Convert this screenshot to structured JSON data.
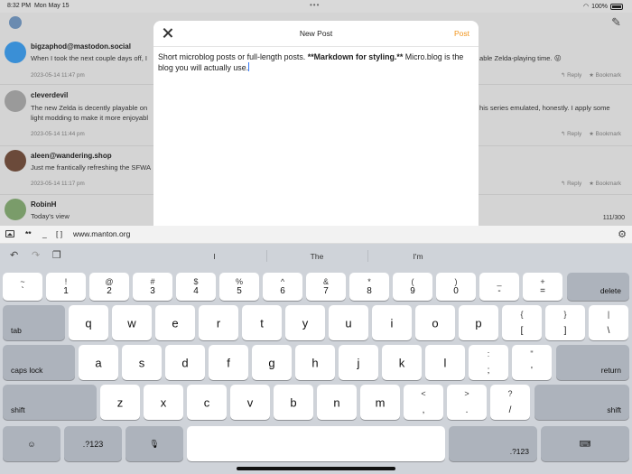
{
  "status": {
    "time": "8:32 PM",
    "date": "Mon May 15",
    "dots": "•••",
    "battery": "100%"
  },
  "timeline": {
    "counter": "111/300",
    "posts": [
      {
        "author": "bigzaphod@mastodon.social",
        "text_left": "When I took the next couple days off, I",
        "text_right": "able Zelda-playing time. 😜",
        "date": "2023-05-14 11:47 pm",
        "reply": "Reply",
        "bookmark": "Bookmark"
      },
      {
        "author": "cleverdevil",
        "text_left": "The new Zelda is decently playable on",
        "text_left2": "light modding to make it more enjoyabl",
        "text_right": "his series emulated, honestly. I apply some",
        "date": "2023-05-14 11:44 pm",
        "reply": "Reply",
        "bookmark": "Bookmark"
      },
      {
        "author": "aleen@wandering.shop",
        "text_left": "Just me frantically refreshing the SFWA",
        "date": "2023-05-14 11:17 pm",
        "reply": "Reply",
        "bookmark": "Bookmark"
      },
      {
        "author": "RobinH",
        "text_left": "Today's view"
      }
    ]
  },
  "modal": {
    "title": "New Post",
    "post_label": "Post",
    "text_part1": "Short microblog posts or full-length posts. ",
    "text_bold": "**Markdown for styling.**",
    "text_part2": " Micro.blog is the blog you will actually use."
  },
  "accessory": {
    "bold": "**",
    "italic": "_",
    "link": "[ ]",
    "site": "www.manton.org"
  },
  "keyboard": {
    "suggestions": [
      "I",
      "The",
      "I'm"
    ],
    "row1": [
      {
        "top": "~",
        "bot": "`"
      },
      {
        "top": "!",
        "bot": "1"
      },
      {
        "top": "@",
        "bot": "2"
      },
      {
        "top": "#",
        "bot": "3"
      },
      {
        "top": "$",
        "bot": "4"
      },
      {
        "top": "%",
        "bot": "5"
      },
      {
        "top": "^",
        "bot": "6"
      },
      {
        "top": "&",
        "bot": "7"
      },
      {
        "top": "*",
        "bot": "8"
      },
      {
        "top": "(",
        "bot": "9"
      },
      {
        "top": ")",
        "bot": "0"
      },
      {
        "top": "_",
        "bot": "-"
      },
      {
        "top": "+",
        "bot": "="
      }
    ],
    "delete": "delete",
    "tab": "tab",
    "row2": [
      "q",
      "w",
      "e",
      "r",
      "t",
      "y",
      "u",
      "i",
      "o",
      "p"
    ],
    "row2_sym": [
      {
        "top": "{",
        "bot": "["
      },
      {
        "top": "}",
        "bot": "]"
      },
      {
        "top": "|",
        "bot": "\\"
      }
    ],
    "caps": "caps lock",
    "row3": [
      "a",
      "s",
      "d",
      "f",
      "g",
      "h",
      "j",
      "k",
      "l"
    ],
    "row3_sym": [
      {
        "top": ":",
        "bot": ";"
      },
      {
        "top": "\"",
        "bot": "'"
      }
    ],
    "return": "return",
    "shift": "shift",
    "row4": [
      "z",
      "x",
      "c",
      "v",
      "b",
      "n",
      "m"
    ],
    "row4_sym": [
      {
        "top": "<",
        "bot": ","
      },
      {
        "top": ">",
        "bot": "."
      },
      {
        "top": "?",
        "bot": "/"
      }
    ],
    "numkey": ".?123"
  }
}
